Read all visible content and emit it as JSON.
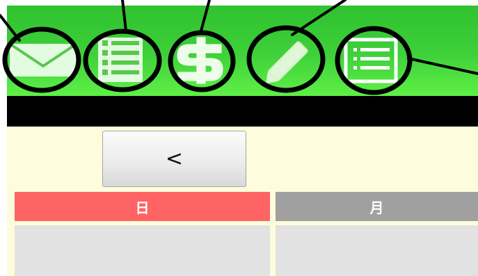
{
  "toolbar": {
    "icons": [
      {
        "name": "mail-icon"
      },
      {
        "name": "list-icon"
      },
      {
        "name": "dollar-icon"
      },
      {
        "name": "pencil-icon"
      },
      {
        "name": "list-box-icon"
      }
    ]
  },
  "calendar": {
    "prev_label": "<",
    "days": [
      {
        "label": "日",
        "color": "#ff6464"
      },
      {
        "label": "月",
        "color": "#a0a0a0"
      }
    ]
  },
  "colors": {
    "toolbar_green": "#3fd13a",
    "background": "#fdfcdc",
    "sunday": "#ff6464",
    "weekday": "#a0a0a0",
    "cell": "#e2e2e2"
  }
}
